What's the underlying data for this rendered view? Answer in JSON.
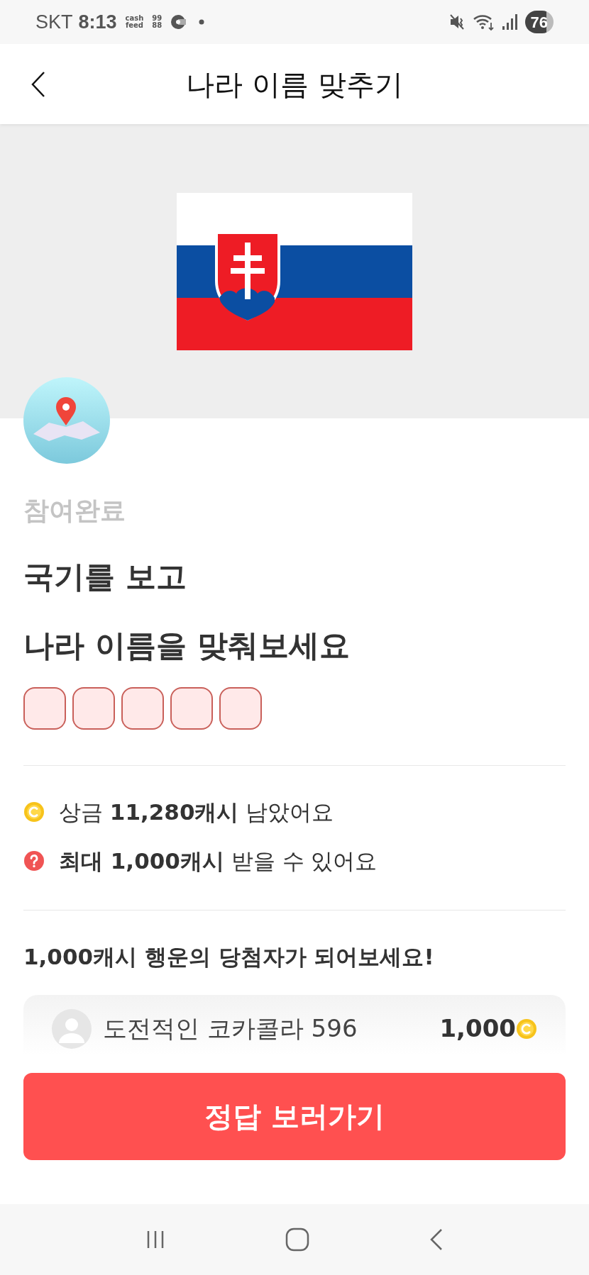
{
  "status_bar": {
    "carrier": "SKT",
    "time": "8:13",
    "notification_texts": [
      "cash\nfeed",
      "99\n88"
    ],
    "battery": "76"
  },
  "header": {
    "title": "나라 이름 맞추기"
  },
  "quiz": {
    "status": "참여완료",
    "title_lines": [
      "국기를 보고",
      "나라 이름을 맞춰보세요"
    ],
    "answer_slots": [
      {
        "filled": false
      },
      {
        "filled": false
      },
      {
        "filled": false
      },
      {
        "filled": false
      },
      {
        "filled": false
      }
    ]
  },
  "info": [
    {
      "kind": "coin",
      "text": "상금 **11,280캐시** 남았어요"
    },
    {
      "kind": "question",
      "text": "**최대 1,000캐시** 받을 수 있어요"
    }
  ],
  "lucky": {
    "title": "1,000캐시 행운의 당첨자가 되어보세요!",
    "winners": [
      {
        "name": "도전적인 코카콜라 596",
        "amount": "1,000"
      }
    ]
  },
  "action_button": "정답 보러가기"
}
